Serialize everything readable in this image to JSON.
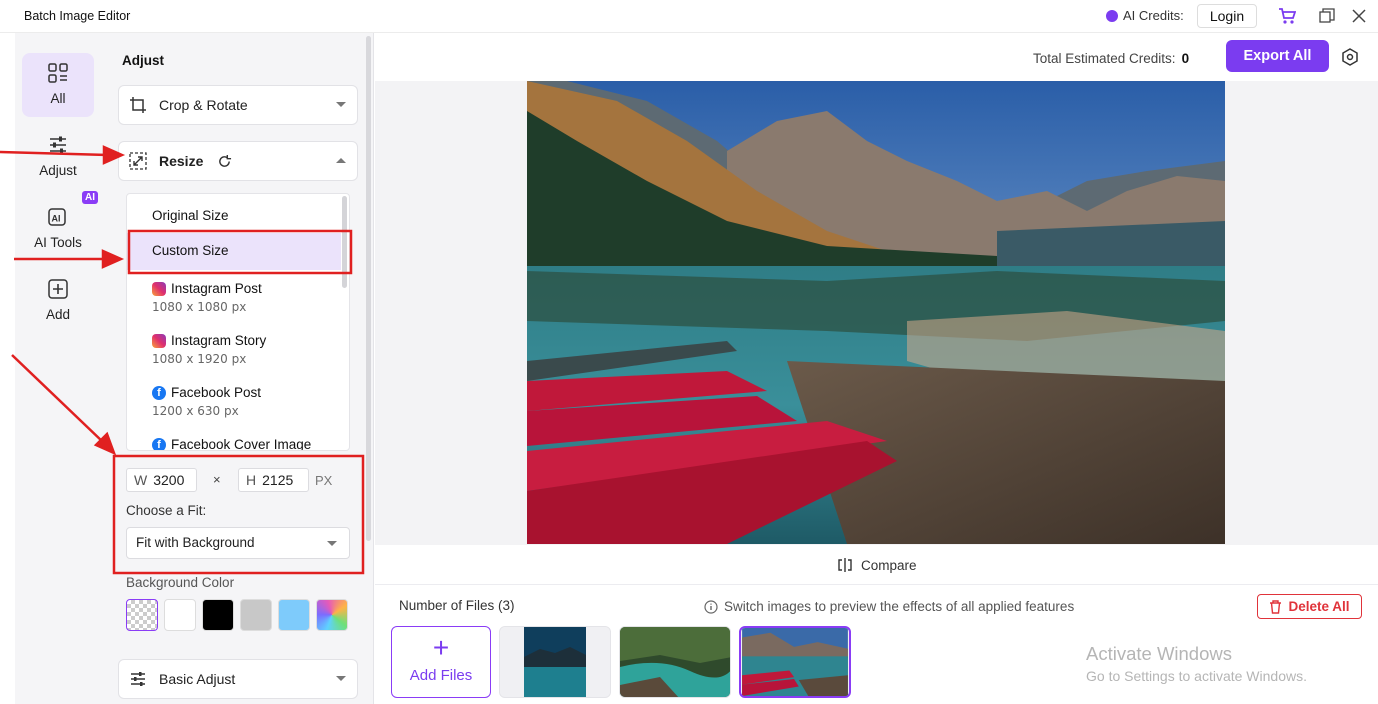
{
  "titlebar": {
    "app_title": "Batch Image Editor",
    "ai_credits_label": "AI Credits:",
    "login_label": "Login"
  },
  "rail": {
    "items": [
      {
        "label": "All",
        "icon": "grid-icon",
        "active": true
      },
      {
        "label": "Adjust",
        "icon": "sliders-icon"
      },
      {
        "label": "AI Tools",
        "icon": "ai-icon",
        "badge": "AI"
      },
      {
        "label": "Add",
        "icon": "add-square-icon"
      }
    ]
  },
  "panel": {
    "title": "Adjust",
    "crop_label": "Crop & Rotate",
    "resize_label": "Resize",
    "sizes": [
      {
        "label": "Original Size",
        "sub": ""
      },
      {
        "label": "Custom Size",
        "sub": ""
      },
      {
        "label": "Instagram Post",
        "sub": "1080 x 1080 px"
      },
      {
        "label": "Instagram Story",
        "sub": "1080 x 1920 px"
      },
      {
        "label": "Facebook Post",
        "sub": "1200 x 630 px"
      },
      {
        "label": "Facebook Cover Image",
        "sub": ""
      }
    ],
    "width_label": "W",
    "width_value": "3200",
    "times": "×",
    "height_label": "H",
    "height_value": "2125",
    "unit": "PX",
    "fit_label": "Choose a Fit:",
    "fit_value": "Fit with Background",
    "bg_color_label": "Background Color",
    "swatches": [
      "transparent",
      "#ffffff",
      "#000000",
      "#c8c8c8",
      "#7ecbfb",
      "gradient"
    ],
    "basic_adjust_label": "Basic Adjust"
  },
  "main": {
    "total_credits_label": "Total Estimated Credits:",
    "total_credits_value": "0",
    "export_label": "Export All",
    "compare_label": "Compare",
    "files_count_label": "Number of Files (3)",
    "hint_text": "Switch images to preview the effects of all applied features",
    "delete_label": "Delete All",
    "add_files_label": "Add Files"
  },
  "watermark": {
    "title": "Activate Windows",
    "subtitle": "Go to Settings to activate Windows."
  },
  "colors": {
    "accent": "#7b3cf0",
    "danger": "#e0333a",
    "annotation": "#e02020"
  }
}
